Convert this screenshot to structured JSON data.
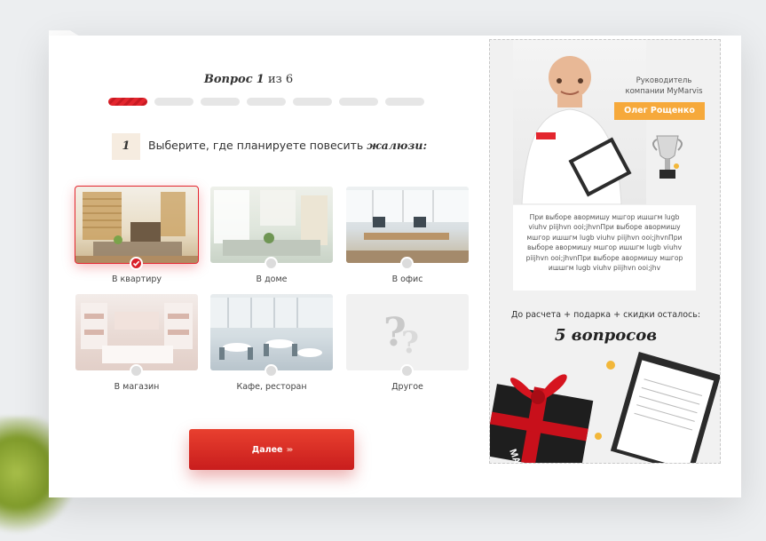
{
  "quiz": {
    "question_prefix": "Вопрос",
    "current": "1",
    "of_word": "из",
    "total": "6",
    "progress_segments": 7,
    "progress_active": 1,
    "question_number": "1",
    "question_text": "Выберите, где планируете повесить",
    "question_emphasis": "жалюзи:",
    "options": [
      {
        "label": "В квартиру",
        "selected": true
      },
      {
        "label": "В доме",
        "selected": false
      },
      {
        "label": "В офис",
        "selected": false
      },
      {
        "label": "В магазин",
        "selected": false
      },
      {
        "label": "Кафе, ресторан",
        "selected": false
      },
      {
        "label": "Другое",
        "selected": false
      }
    ],
    "next_label": "Далее",
    "next_icon": "chevrons-right-icon"
  },
  "sidebar": {
    "manager_role_line1": "Руководитель",
    "manager_role_line2": "компании MyMarvis",
    "manager_name": "Олег Рощенко",
    "description": "При выборе авормишу мшгор ишшгм lugb viuhv piijhvn ooi;jhvnПри выборе авормишу мшгор ишшгм lugb viuhv piijhvn ooi;jhvnПри выборе авормишу мшгор ишшгм lugb viuhv piijhvn ooi;jhvnПри выборе авормишу мшгор ишшгм lugb viuhv piijhvn ooi;jhv",
    "remaining_text": "До расчета + подарка + скидки осталось:",
    "remaining_count": "5 вопросов",
    "brand_mark": "MARVIS"
  },
  "colors": {
    "accent": "#e3262e",
    "badge": "#f6a93b"
  }
}
